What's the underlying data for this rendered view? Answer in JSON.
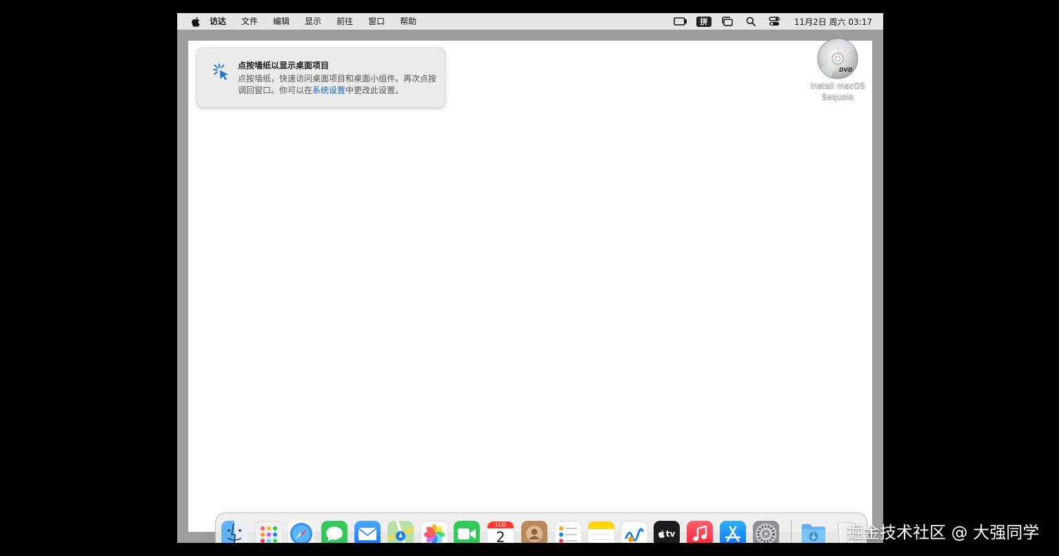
{
  "menubar": {
    "items": [
      "访达",
      "文件",
      "编辑",
      "显示",
      "前往",
      "窗口",
      "帮助"
    ],
    "ime_label": "拼",
    "clock": "11月2日 周六  03:17"
  },
  "tip": {
    "title": "点按墙纸以显示桌面项目",
    "body_part1": "点按墙纸，快速访问桌面项目和桌面小组件。再次点按调回窗口。你可以在",
    "link": "系统设置",
    "body_part2": "中更改此设置。"
  },
  "desktop_item": {
    "label": "Install macOS Sequoia",
    "disc_text": "DVD"
  },
  "dock": {
    "apps": [
      {
        "name": "finder-icon",
        "running": true
      },
      {
        "name": "launchpad-icon"
      },
      {
        "name": "safari-icon"
      },
      {
        "name": "messages-icon"
      },
      {
        "name": "mail-icon"
      },
      {
        "name": "maps-icon"
      },
      {
        "name": "photos-icon"
      },
      {
        "name": "facetime-icon"
      },
      {
        "name": "calendar-icon",
        "month": "11月",
        "day": "2"
      },
      {
        "name": "contacts-icon"
      },
      {
        "name": "reminders-icon"
      },
      {
        "name": "notes-icon"
      },
      {
        "name": "freeform-icon"
      },
      {
        "name": "tv-icon",
        "label": "tv"
      },
      {
        "name": "music-icon"
      },
      {
        "name": "app-store-icon"
      },
      {
        "name": "system-settings-icon"
      },
      {
        "name": "downloads-folder-icon"
      },
      {
        "name": "trash-icon"
      }
    ]
  },
  "watermark": "掘金技术社区 @ 大强同学",
  "colors": {
    "outer_background": "#000000",
    "screen_border": "#9e9e9e",
    "menubar": "#e6e6e6",
    "wallpaper": "#ffffff",
    "link": "#1565c0"
  }
}
